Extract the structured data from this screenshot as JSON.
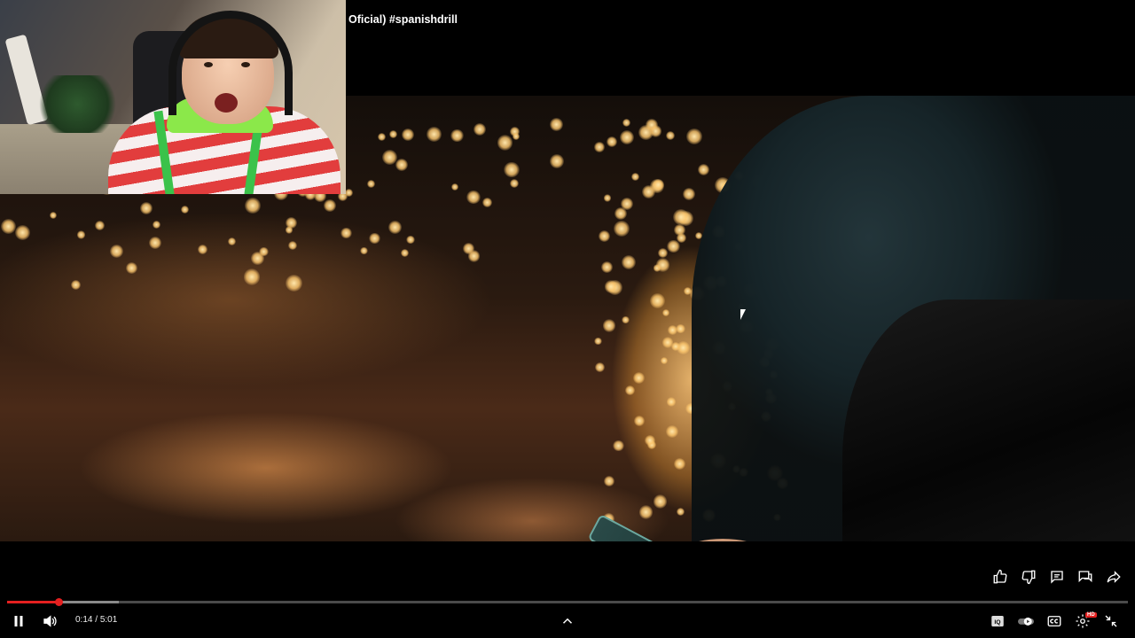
{
  "video": {
    "title": "Oficial) #spanishdrill"
  },
  "player": {
    "current_time": "0:14",
    "separator": "/",
    "duration": "5:01",
    "progress_fraction": 0.046,
    "buffered_fraction": 0.1,
    "hd_badge": "HD"
  },
  "icons": {
    "like": "thumbs-up-icon",
    "dislike": "thumbs-down-icon",
    "comments": "comment-icon",
    "chat": "chat-icon",
    "share": "share-icon",
    "pause": "pause-icon",
    "volume": "volume-icon",
    "expand": "chevron-up-icon",
    "ambient": "iq-icon",
    "autoplay": "autoplay-toggle-icon",
    "captions": "cc-icon",
    "settings": "gear-icon",
    "exit_fullscreen": "exit-fullscreen-icon"
  },
  "colors": {
    "progress_played": "#e52020",
    "background": "#000000"
  }
}
